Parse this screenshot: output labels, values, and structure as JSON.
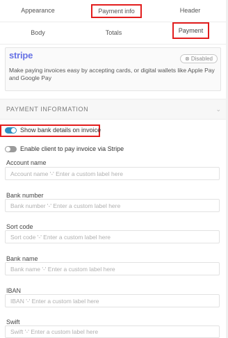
{
  "tabs_row1": [
    {
      "label": "Appearance"
    },
    {
      "label": "Payment info"
    },
    {
      "label": "Header"
    }
  ],
  "tabs_row2": [
    {
      "label": "Body"
    },
    {
      "label": "Totals"
    },
    {
      "label": "Payment"
    }
  ],
  "stripe": {
    "logo": "stripe",
    "badge": "⊗ Disabled",
    "description": "Make paying invoices easy by accepting cards, or digital wallets like Apple Pay and Google Pay"
  },
  "section": {
    "title": "PAYMENT INFORMATION",
    "chevron": "⌄"
  },
  "toggles": {
    "show_bank": {
      "label": "Show bank details on invoice",
      "on": true
    },
    "stripe_pay": {
      "label": "Enable client to pay invoice via Stripe",
      "on": false
    }
  },
  "fields": [
    {
      "label": "Account name",
      "placeholder": "Account name '-' Enter a custom label here"
    },
    {
      "label": "Bank number",
      "placeholder": "Bank number '-' Enter a custom label here"
    },
    {
      "label": "Sort code",
      "placeholder": "Sort code '-' Enter a custom label here"
    },
    {
      "label": "Bank name",
      "placeholder": "Bank name '-' Enter a custom label here"
    },
    {
      "label": "IBAN",
      "placeholder": "IBAN '-' Enter a custom label here"
    },
    {
      "label": "Swift",
      "placeholder": "Swift '-' Enter a custom label here"
    }
  ],
  "colors": {
    "highlight": "#e21d1d",
    "stripe_brand": "#6772e5",
    "toggle_on": "#2d8fc0"
  }
}
